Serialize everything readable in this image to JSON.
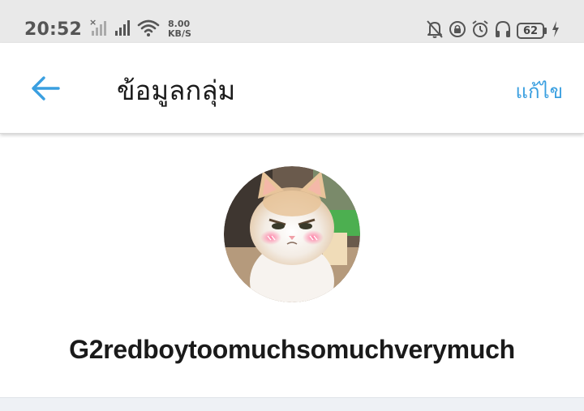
{
  "status_bar": {
    "time": "20:52",
    "net_speed_value": "8.00",
    "net_speed_unit": "KB/S",
    "battery_level": "62",
    "icons": [
      "signal-no-sim-icon",
      "signal-icon",
      "wifi-icon",
      "mute-icon",
      "lock-rotation-icon",
      "alarm-icon",
      "headphones-icon",
      "battery-icon",
      "charging-icon"
    ]
  },
  "app_bar": {
    "title": "ข้อมูลกลุ่ม",
    "edit_label": "แก้ไข",
    "back_icon": "arrow-left-icon"
  },
  "group": {
    "name": "G2redboytoomuchsomuchverymuch",
    "avatar_description_icon": "cat-avatar"
  },
  "colors": {
    "accent": "#3a9fe0",
    "status_bar_bg": "#e9e9e9",
    "title_text": "#1b1b1b"
  }
}
